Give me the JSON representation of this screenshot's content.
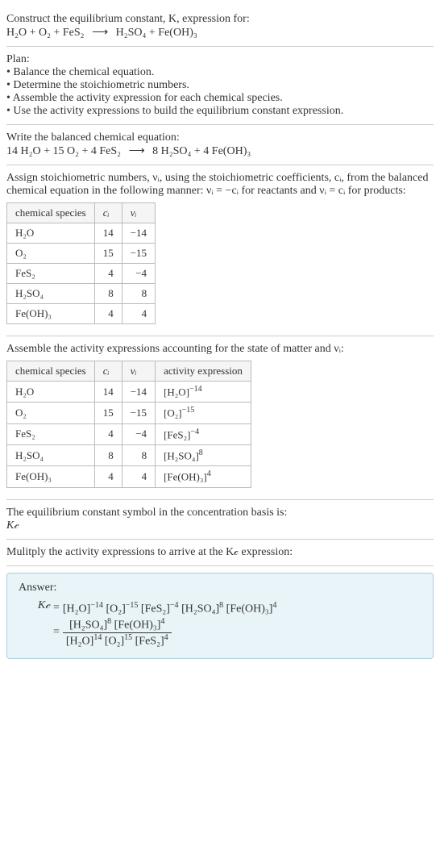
{
  "prompt": {
    "line1": "Construct the equilibrium constant, K, expression for:",
    "eq_lhs": "H₂O + O₂ + FeS₂",
    "eq_rhs": "H₂SO₄ + Fe(OH)₃"
  },
  "plan": {
    "heading": "Plan:",
    "b1": "• Balance the chemical equation.",
    "b2": "• Determine the stoichiometric numbers.",
    "b3": "• Assemble the activity expression for each chemical species.",
    "b4": "• Use the activity expressions to build the equilibrium constant expression."
  },
  "balanced": {
    "heading": "Write the balanced chemical equation:",
    "eq_lhs": "14 H₂O + 15 O₂ + 4 FeS₂",
    "eq_rhs": "8 H₂SO₄ + 4 Fe(OH)₃"
  },
  "stoich": {
    "intro": "Assign stoichiometric numbers, νᵢ, using the stoichiometric coefficients, cᵢ, from the balanced chemical equation in the following manner: νᵢ = −cᵢ for reactants and νᵢ = cᵢ for products:",
    "h1": "chemical species",
    "h2": "cᵢ",
    "h3": "νᵢ",
    "r1s": "H₂O",
    "r1c": "14",
    "r1v": "−14",
    "r2s": "O₂",
    "r2c": "15",
    "r2v": "−15",
    "r3s": "FeS₂",
    "r3c": "4",
    "r3v": "−4",
    "r4s": "H₂SO₄",
    "r4c": "8",
    "r4v": "8",
    "r5s": "Fe(OH)₃",
    "r5c": "4",
    "r5v": "4"
  },
  "activity": {
    "intro": "Assemble the activity expressions accounting for the state of matter and νᵢ:",
    "h1": "chemical species",
    "h2": "cᵢ",
    "h3": "νᵢ",
    "h4": "activity expression",
    "r1s": "H₂O",
    "r1c": "14",
    "r1v": "−14",
    "r1a_base": "[H₂O]",
    "r1a_exp": "−14",
    "r2s": "O₂",
    "r2c": "15",
    "r2v": "−15",
    "r2a_base": "[O₂]",
    "r2a_exp": "−15",
    "r3s": "FeS₂",
    "r3c": "4",
    "r3v": "−4",
    "r3a_base": "[FeS₂]",
    "r3a_exp": "−4",
    "r4s": "H₂SO₄",
    "r4c": "8",
    "r4v": "8",
    "r4a_base": "[H₂SO₄]",
    "r4a_exp": "8",
    "r5s": "Fe(OH)₃",
    "r5c": "4",
    "r5v": "4",
    "r5a_base": "[Fe(OH)₃]",
    "r5a_exp": "4"
  },
  "symbol": {
    "line1": "The equilibrium constant symbol in the concentration basis is:",
    "line2": "K𝒸"
  },
  "multiply": {
    "line": "Mulitply the activity expressions to arrive at the K𝒸 expression:"
  },
  "answer": {
    "label": "Answer:",
    "kc": "K𝒸",
    "eq": "=",
    "t1_base": "[H₂O]",
    "t1_exp": "−14",
    "t2_base": "[O₂]",
    "t2_exp": "−15",
    "t3_base": "[FeS₂]",
    "t3_exp": "−4",
    "t4_base": "[H₂SO₄]",
    "t4_exp": "8",
    "t5_base": "[Fe(OH)₃]",
    "t5_exp": "4",
    "n1_base": "[H₂SO₄]",
    "n1_exp": "8",
    "n2_base": "[Fe(OH)₃]",
    "n2_exp": "4",
    "d1_base": "[H₂O]",
    "d1_exp": "14",
    "d2_base": "[O₂]",
    "d2_exp": "15",
    "d3_base": "[FeS₂]",
    "d3_exp": "4"
  }
}
